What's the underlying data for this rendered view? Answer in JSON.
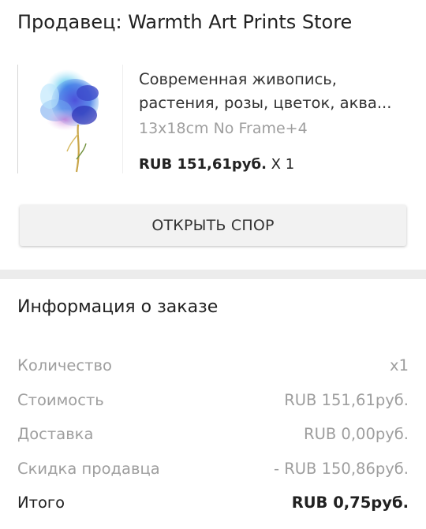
{
  "seller": {
    "label": "Продавец: Warmth Art Prints Store"
  },
  "product": {
    "image_icon": "flower-painting-image",
    "title": "Современная живопись, растения, розы, цветок, аква...",
    "variant": "13x18cm No Frame+4",
    "price": "RUB 151,61руб.",
    "quantity": " X 1"
  },
  "dispute_button": {
    "label": "ОТКРЫТЬ СПОР"
  },
  "order_info": {
    "title": "Информация о заказе",
    "rows": [
      {
        "label": "Количество",
        "value": "x1"
      },
      {
        "label": "Стоимость",
        "value": "RUB 151,61руб."
      },
      {
        "label": "Доставка",
        "value": "RUB 0,00руб."
      },
      {
        "label": "Скидка продавца",
        "value": "- RUB 150,86руб."
      }
    ],
    "total": {
      "label": "Итого",
      "value": "RUB 0,75руб."
    }
  },
  "colors": {
    "primary_text": "#212121",
    "secondary_text": "#9e9e9e",
    "button_bg": "#f2f2f2",
    "divider": "#ececec"
  }
}
